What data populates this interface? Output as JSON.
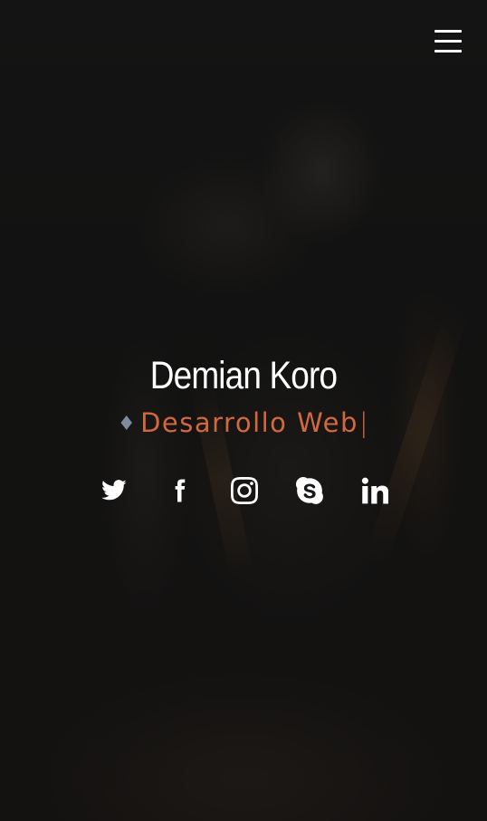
{
  "header": {
    "menu_icon": "hamburger-menu-icon"
  },
  "hero": {
    "name": "Demian Koro",
    "role_bullet": "♦",
    "role": "Desarrollo Web",
    "cursor": "|"
  },
  "social": [
    {
      "name": "twitter",
      "icon": "twitter-icon"
    },
    {
      "name": "facebook",
      "icon": "facebook-icon"
    },
    {
      "name": "instagram",
      "icon": "instagram-icon"
    },
    {
      "name": "skype",
      "icon": "skype-icon"
    },
    {
      "name": "linkedin",
      "icon": "linkedin-icon"
    }
  ],
  "colors": {
    "accent": "#d2693e",
    "bullet": "#7f8c9e",
    "text": "#ffffff",
    "background": "#161616"
  }
}
